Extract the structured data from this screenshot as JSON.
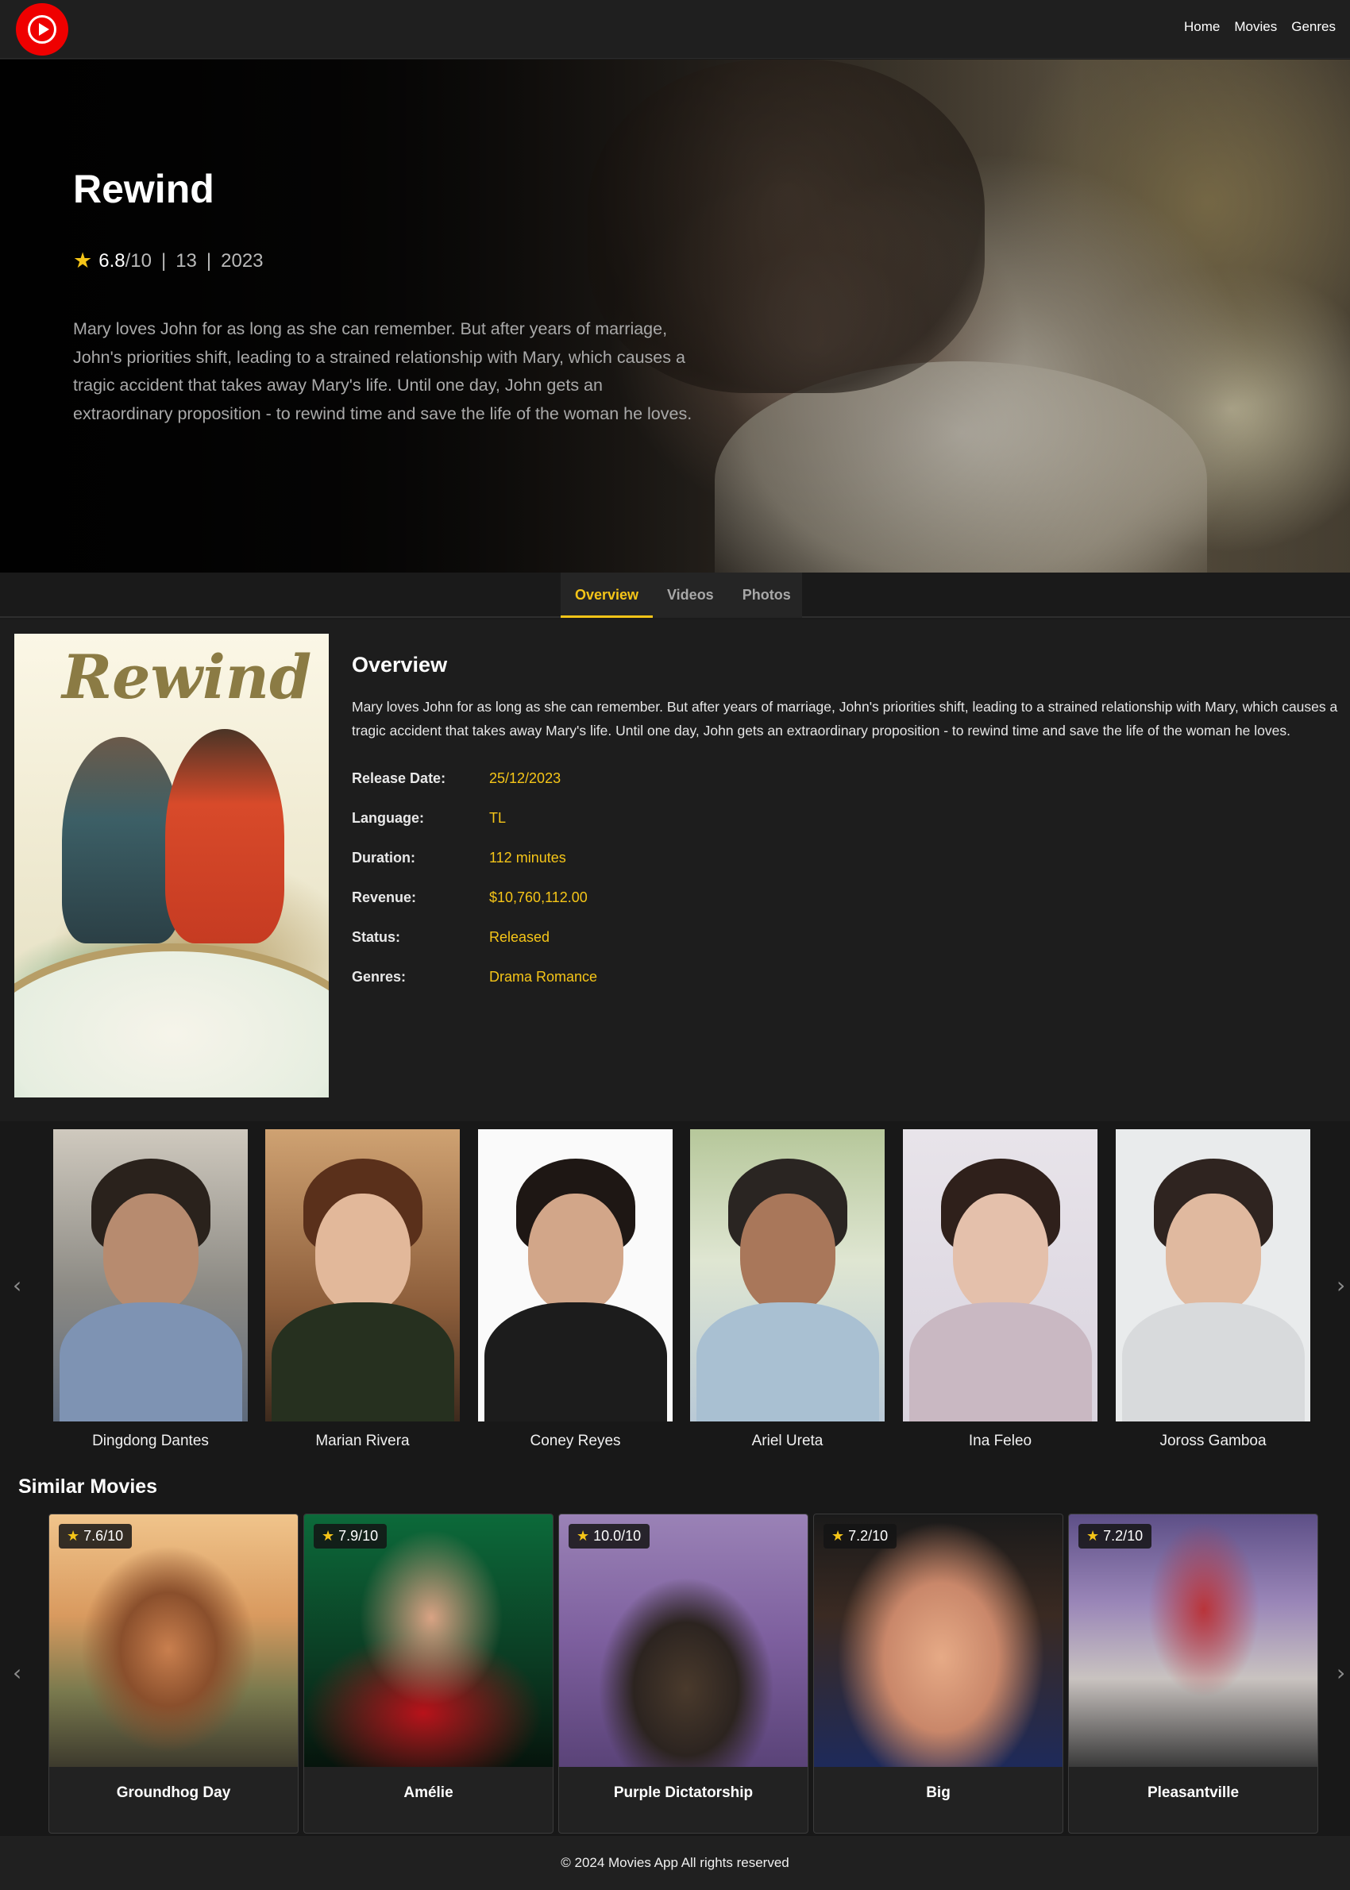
{
  "header": {
    "logo_icon": "play-circle-icon",
    "nav": [
      {
        "label": "Home"
      },
      {
        "label": "Movies"
      },
      {
        "label": "Genres"
      }
    ]
  },
  "hero": {
    "title": "Rewind",
    "rating": "6.8",
    "rating_suffix": "/10",
    "separator": "|",
    "rated": "13",
    "year": "2023",
    "star_icon": "star-icon",
    "description": "Mary loves John for as long as she can remember. But after years of marriage, John's priorities shift, leading to a strained relationship with Mary, which causes a tragic accident that takes away Mary's life. Until one day, John gets an extraordinary proposition - to rewind time and save the life of the woman he loves."
  },
  "tabs": [
    {
      "label": "Overview",
      "active": true
    },
    {
      "label": "Videos",
      "active": false
    },
    {
      "label": "Photos",
      "active": false
    }
  ],
  "overview": {
    "poster_title": "Rewind",
    "heading": "Overview",
    "text": "Mary loves John for as long as she can remember. But after years of marriage, John's priorities shift, leading to a strained relationship with Mary, which causes a tragic accident that takes away Mary's life. Until one day, John gets an extraordinary proposition - to rewind time and save the life of the woman he loves.",
    "details": [
      {
        "label": "Release Date:",
        "value": "25/12/2023"
      },
      {
        "label": "Language:",
        "value": "TL"
      },
      {
        "label": "Duration:",
        "value": "112 minutes"
      },
      {
        "label": "Revenue:",
        "value": "$10,760,112.00"
      },
      {
        "label": "Status:",
        "value": "Released"
      },
      {
        "label": "Genres:",
        "value": "Drama Romance"
      }
    ]
  },
  "cast": {
    "prev_icon": "chevron-left-icon",
    "next_icon": "chevron-right-icon",
    "members": [
      {
        "name": "Dingdong Dantes"
      },
      {
        "name": "Marian Rivera"
      },
      {
        "name": "Coney Reyes"
      },
      {
        "name": "Ariel Ureta"
      },
      {
        "name": "Ina Feleo"
      },
      {
        "name": "Joross Gamboa"
      }
    ]
  },
  "similar": {
    "heading": "Similar Movies",
    "movies": [
      {
        "title": "Groundhog Day",
        "rating": "7.6/10"
      },
      {
        "title": "Amélie",
        "rating": "7.9/10"
      },
      {
        "title": "Purple Dictatorship",
        "rating": "10.0/10"
      },
      {
        "title": "Big",
        "rating": "7.2/10"
      },
      {
        "title": "Pleasantville",
        "rating": "7.2/10"
      }
    ]
  },
  "footer": {
    "text": "© 2024 Movies App All rights reserved"
  },
  "colors": {
    "accent": "#f5c518",
    "brand_red": "#ef0000",
    "background": "#1b1b1b"
  }
}
